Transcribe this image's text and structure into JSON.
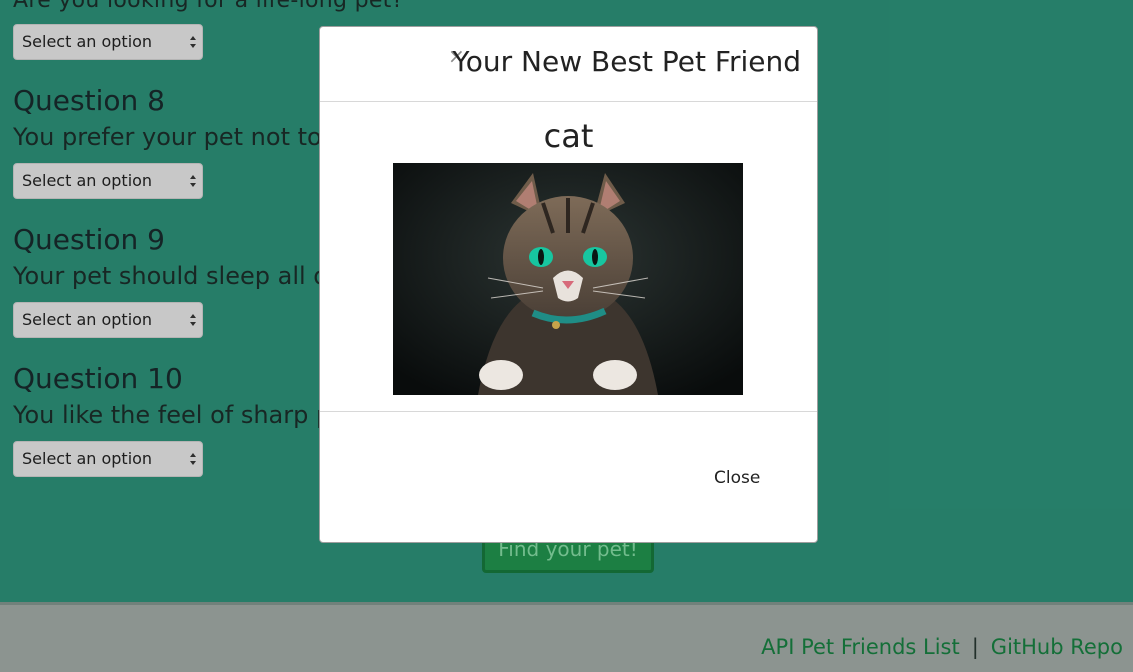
{
  "quiz": {
    "intro_question_text": "Are you looking for a life-long pet?",
    "select_placeholder": "Select an option",
    "questions": [
      {
        "title": "Question 8",
        "text": "You prefer your pet not to"
      },
      {
        "title": "Question 9",
        "text": "Your pet should sleep all d"
      },
      {
        "title": "Question 10",
        "text": "You like the feel of sharp p"
      }
    ],
    "submit_label": "Find your pet!"
  },
  "modal": {
    "close_symbol": "×",
    "title": "Your New Best Pet Friend",
    "pet_name": "cat",
    "close_label": "Close"
  },
  "footer": {
    "link_api": "API Pet Friends List",
    "separator": "|",
    "link_github": "GitHub Repo"
  },
  "colors": {
    "page_background": "#2a8a73",
    "button_green": "#1f8c4a",
    "footer_link": "#167a3e",
    "footer_background": "#9aa39f"
  }
}
